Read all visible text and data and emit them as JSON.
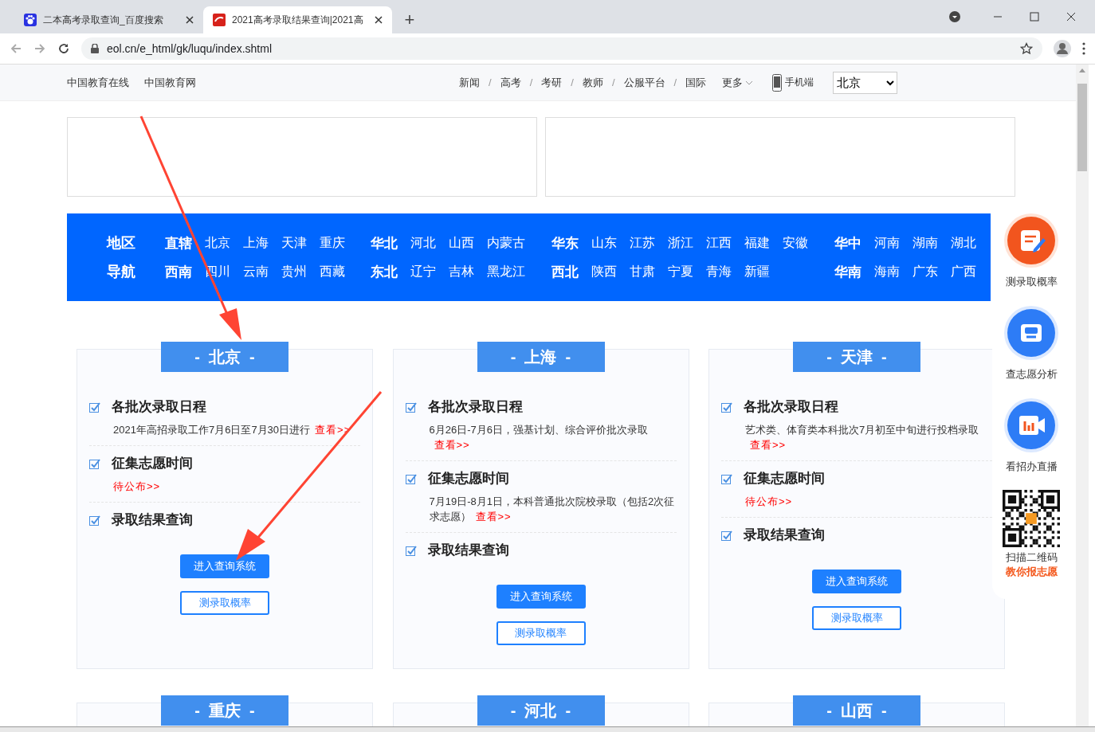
{
  "browser": {
    "tabs": [
      {
        "title": "二本高考录取查询_百度搜索",
        "selected": false
      },
      {
        "title": "2021高考录取结果查询|2021高",
        "selected": true
      }
    ],
    "new_tab": "+",
    "address": "eol.cn/e_html/gk/luqu/index.shtml"
  },
  "site_nav": {
    "left_links": [
      "中国教育在线",
      "中国教育网"
    ],
    "right_links": [
      "新闻",
      "高考",
      "考研",
      "教师",
      "公服平台",
      "国际"
    ],
    "separator": "/",
    "more": "更多",
    "mobile": "手机端",
    "region_select": "北京"
  },
  "region_nav": {
    "labels": [
      "地区",
      "导航"
    ],
    "rows": [
      [
        {
          "name": "直辖",
          "items": [
            "北京",
            "上海",
            "天津",
            "重庆"
          ]
        },
        {
          "name": "华北",
          "items": [
            "河北",
            "山西",
            "内蒙古"
          ]
        },
        {
          "name": "华东",
          "items": [
            "山东",
            "江苏",
            "浙江",
            "江西",
            "福建",
            "安徽"
          ]
        },
        {
          "name": "华中",
          "items": [
            "河南",
            "湖南",
            "湖北"
          ]
        }
      ],
      [
        {
          "name": "西南",
          "items": [
            "四川",
            "云南",
            "贵州",
            "西藏"
          ]
        },
        {
          "name": "东北",
          "items": [
            "辽宁",
            "吉林",
            "黑龙江"
          ]
        },
        {
          "name": "西北",
          "items": [
            "陕西",
            "甘肃",
            "宁夏",
            "青海",
            "新疆"
          ]
        },
        {
          "name": "华南",
          "items": [
            "海南",
            "广东",
            "广西"
          ]
        }
      ]
    ]
  },
  "cards": [
    {
      "title": "-  北京  -",
      "items": [
        {
          "title": "各批次录取日程",
          "text": "2021年高招录取工作7月6日至7月30日进行",
          "link": "查看>>"
        },
        {
          "title": "征集志愿时间",
          "link": "待公布>>"
        },
        {
          "title": "录取结果查询"
        }
      ],
      "buttons": [
        {
          "label": "进入查询系统",
          "kind": "primary"
        },
        {
          "label": "测录取概率",
          "kind": "outline"
        }
      ]
    },
    {
      "title": "-  上海  -",
      "items": [
        {
          "title": "各批次录取日程",
          "text": "6月26日-7月6日，强基计划、综合评价批次录取",
          "link": "查看>>"
        },
        {
          "title": "征集志愿时间",
          "text": "7月19日-8月1日，本科普通批次院校录取（包括2次征求志愿）",
          "link": "查看>>"
        },
        {
          "title": "录取结果查询"
        }
      ],
      "buttons": [
        {
          "label": "进入查询系统",
          "kind": "primary"
        },
        {
          "label": "测录取概率",
          "kind": "outline"
        }
      ]
    },
    {
      "title": "-  天津  -",
      "items": [
        {
          "title": "各批次录取日程",
          "text": "艺术类、体育类本科批次7月初至中旬进行投档录取",
          "link": "查看>>"
        },
        {
          "title": "征集志愿时间",
          "link": "待公布>>"
        },
        {
          "title": "录取结果查询"
        }
      ],
      "buttons": [
        {
          "label": "进入查询系统",
          "kind": "primary"
        },
        {
          "label": "测录取概率",
          "kind": "outline"
        }
      ]
    },
    {
      "title": "-  重庆  -"
    },
    {
      "title": "-  河北  -"
    },
    {
      "title": "-  山西  -"
    }
  ],
  "sidebar": {
    "items": [
      {
        "label": "测录取概率",
        "kind": "pen"
      },
      {
        "label": "查志愿分析",
        "kind": "bag"
      },
      {
        "label": "看招办直播",
        "kind": "video"
      }
    ],
    "qr_caption": "扫描二维码",
    "qr_highlight": "教你报志愿"
  }
}
